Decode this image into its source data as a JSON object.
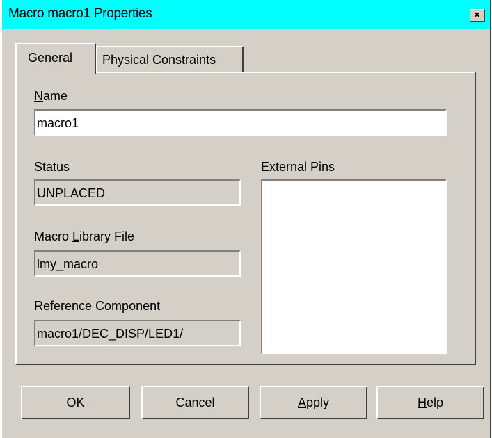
{
  "window": {
    "title": "Macro macro1 Properties",
    "close_glyph": "×"
  },
  "tabs": [
    {
      "label": "General",
      "active": true
    },
    {
      "label": "Physical Constraints",
      "active": false
    }
  ],
  "form": {
    "name_label_key": "N",
    "name_label_rest": "ame",
    "name_value": "macro1",
    "status_label_key": "S",
    "status_label_rest": "tatus",
    "status_value": "UNPLACED",
    "library_label_pre": "Macro ",
    "library_label_key": "L",
    "library_label_rest": "ibrary File",
    "library_value": "lmy_macro",
    "reference_label_key": "R",
    "reference_label_rest": "eference Component",
    "reference_value": "macro1/DEC_DISP/LED1/",
    "pins_label_key": "E",
    "pins_label_rest": "xternal Pins",
    "pins_items": []
  },
  "buttons": {
    "ok": "OK",
    "cancel": "Cancel",
    "apply_key": "A",
    "apply_rest": "pply",
    "help_key": "H",
    "help_rest": "elp"
  },
  "colors": {
    "titlebar": "#00ffff",
    "face": "#d4d0c8"
  }
}
